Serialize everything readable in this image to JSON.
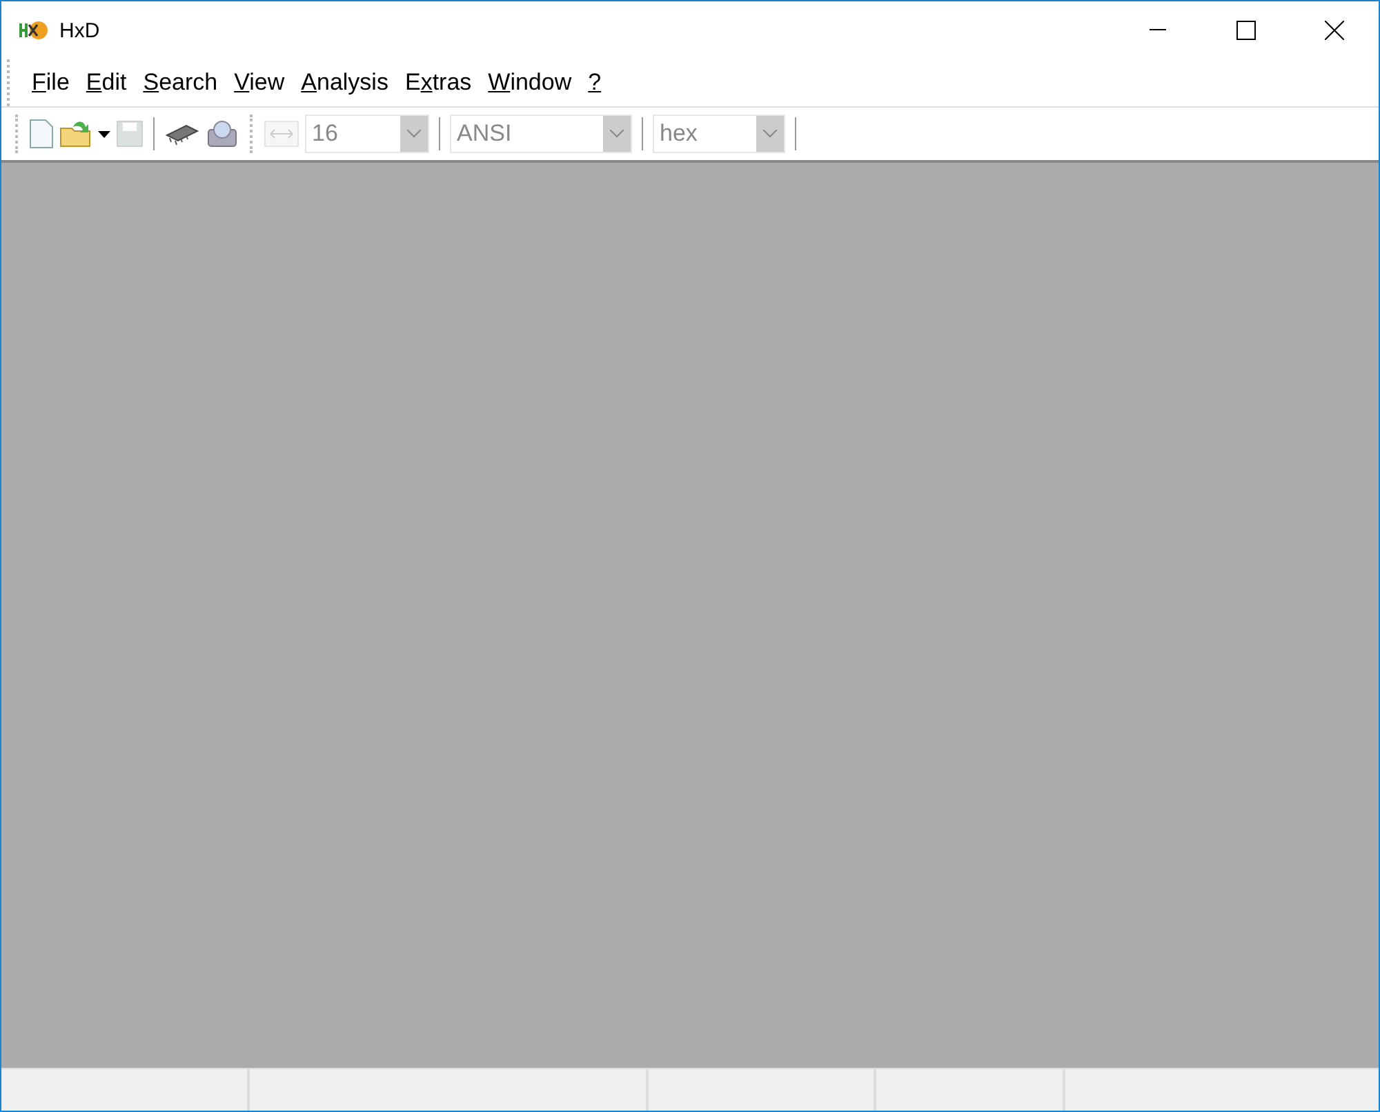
{
  "window": {
    "title": "HxD"
  },
  "menu": [
    {
      "key": "F",
      "rest": "ile"
    },
    {
      "key": "E",
      "rest": "dit"
    },
    {
      "key": "S",
      "rest": "earch"
    },
    {
      "key": "V",
      "rest": "iew"
    },
    {
      "key": "A",
      "rest": "nalysis"
    },
    {
      "key": "x",
      "rest": "tras",
      "pre": "E"
    },
    {
      "key": "W",
      "rest": "indow"
    },
    {
      "key": "?"
    }
  ],
  "toolbar": {
    "save_disabled": true,
    "combos": [
      {
        "value": "16",
        "disabled": true
      },
      {
        "value": "ANSI",
        "disabled": true
      },
      {
        "value": "hex",
        "disabled": true
      }
    ]
  }
}
